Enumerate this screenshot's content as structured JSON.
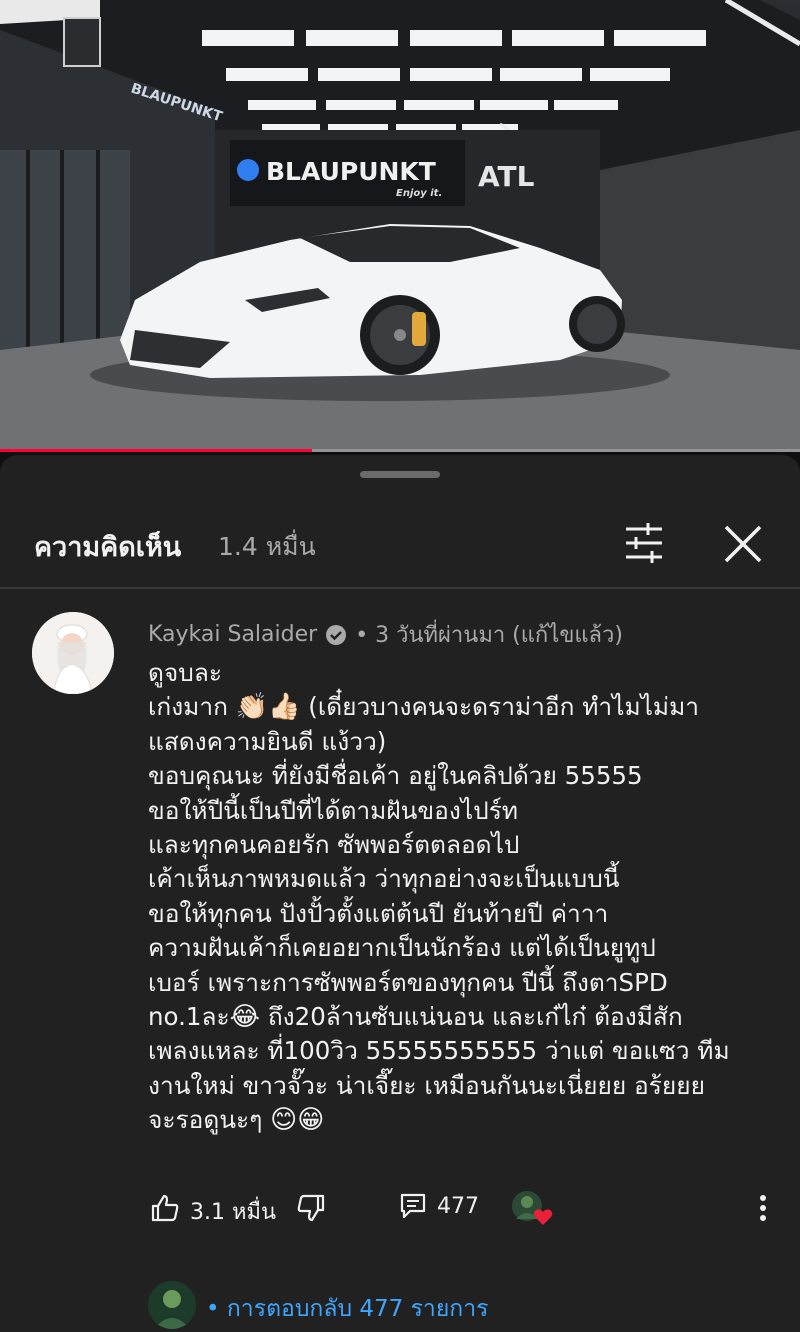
{
  "video": {
    "brand_sign": "BLAUPUNKT",
    "brand_tagline": "Enjoy it.",
    "partner_logo": "ATL",
    "progress_fraction": 0.39
  },
  "comments_panel": {
    "title": "ความคิดเห็น",
    "count": "1.4 หมื่น",
    "filter_icon": "sliders-icon",
    "close_icon": "close-icon"
  },
  "comment": {
    "author": "Kaykai Salaider",
    "verified_icon": "verified-check-icon",
    "time": "• 3 วันที่ผ่านมา (แก้ไขแล้ว)",
    "lines": [
      "ดูจบละ",
      "เก่งมาก",
      "👏🏻👍🏻",
      "(เดี๋ยวบางคนจะดราม่าอีก ทำไมไม่มา",
      "แสดงความยินดี แง้วว)",
      "ขอบคุณนะ ที่ยังมีชื่อเค้า อยู่ในคลิปด้วย 55555",
      "ขอให้ปีนี้เป็นปีที่ได้ตามฝันของไปร์ท",
      "และทุกคนคอยรัก ซัพพอร์ตตลอดไป",
      "เค้าเห็นภาพหมดแล้ว ว่าทุกอย่างจะเป็นแบบนี้",
      "ขอให้ทุกคน ปังปั้วตั้งแต่ต้นปี ยันท้ายปี ค่าาา",
      "ความฝันเค้าก็เคยอยากเป็นนักร้อง แต่ได้เป็นยูทูป",
      "เบอร์ เพราะการซัพพอร์ตของทุกคน ปีนี้ ถึงตาSPD",
      "no.1ละ",
      "😂",
      " ถึง20ล้านซับแน่นอน และเก๋ไก๋ ต้องมีสัก",
      "เพลงแหละ ที่100วิว 55555555555 ว่าแต่ ขอแซว ทีม",
      "งานใหม่ ขาวจั๊วะ น่าเจี๊ยะ เหมือนกันนะเนี่ยยย อร้ยยย",
      "จะรอดูนะๆ",
      "😊😁"
    ],
    "likes": "3.1 หมื่น",
    "replies": "477",
    "like_icon": "thumb-up-icon",
    "dislike_icon": "thumb-down-icon",
    "reply_icon": "reply-comment-icon",
    "more_icon": "more-vertical-icon"
  },
  "replies_link": "• การตอบกลับ 477 รายการ",
  "colors": {
    "background": "#0f0f0f",
    "sheet": "#212121",
    "text_primary": "#f1f1f1",
    "text_secondary": "#aaaaaa",
    "link": "#3ea6ff",
    "progress": "#ff0033",
    "heart": "#e8203a"
  }
}
